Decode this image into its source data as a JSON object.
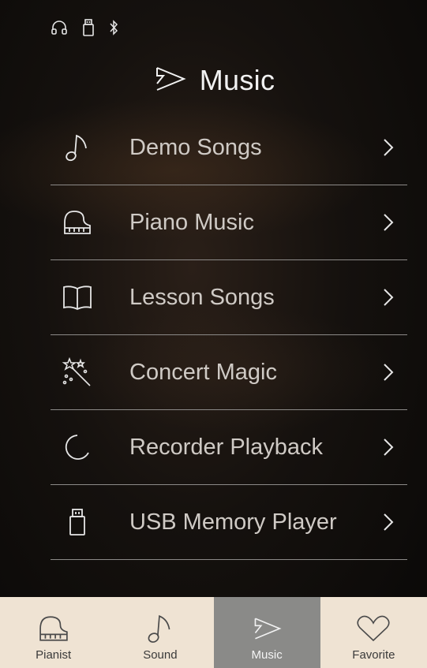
{
  "status_bar": {
    "icons": [
      "headphones-icon",
      "usb-icon",
      "bluetooth-icon"
    ]
  },
  "header": {
    "title": "Music",
    "icon": "play-outline-icon"
  },
  "menu": {
    "items": [
      {
        "label": "Demo Songs",
        "icon": "music-note-icon"
      },
      {
        "label": "Piano Music",
        "icon": "piano-icon"
      },
      {
        "label": "Lesson Songs",
        "icon": "book-icon"
      },
      {
        "label": "Concert Magic",
        "icon": "magic-wand-icon"
      },
      {
        "label": "Recorder Playback",
        "icon": "record-circle-icon"
      },
      {
        "label": "USB Memory Player",
        "icon": "usb-icon"
      }
    ]
  },
  "tabbar": {
    "tabs": [
      {
        "label": "Pianist",
        "icon": "piano-icon"
      },
      {
        "label": "Sound",
        "icon": "music-note-icon"
      },
      {
        "label": "Music",
        "icon": "play-outline-icon",
        "active": true
      },
      {
        "label": "Favorite",
        "icon": "heart-icon"
      }
    ]
  },
  "colors": {
    "background": "#15110e",
    "text": "#cfcac5",
    "divider": "#8c8a88",
    "tab_bg": "#efe3d3",
    "tab_active_bg": "#8a8a88"
  }
}
